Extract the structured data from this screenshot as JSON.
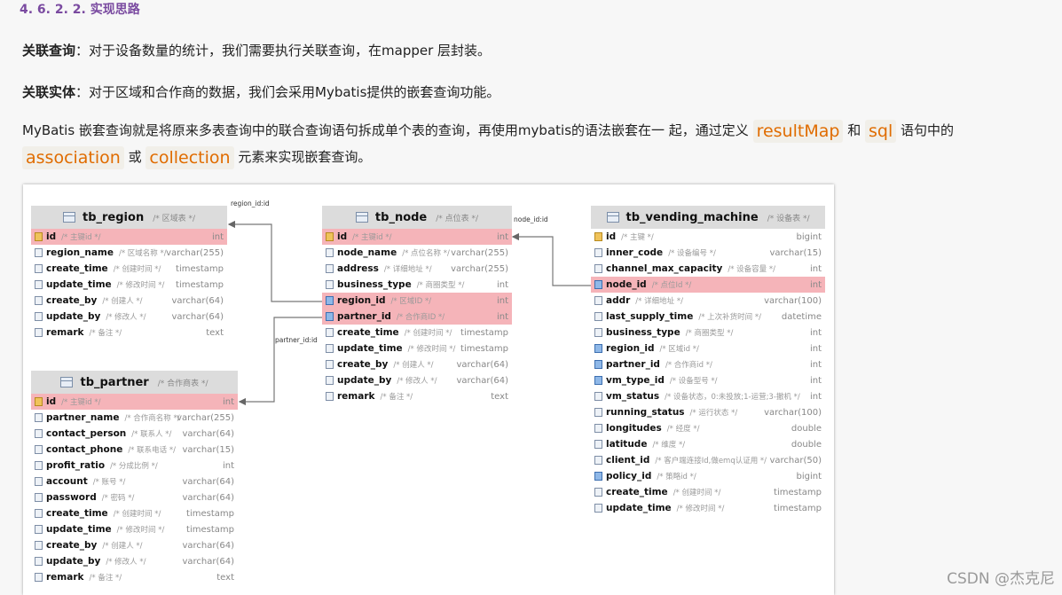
{
  "heading": "4. 6. 2. 2.  实现思路",
  "p1": {
    "bold": "关联查询",
    "text": "：对于设备数量的统计，我们需要执行关联查询，在mapper 层封装。"
  },
  "p2": {
    "bold": "关联实体",
    "text": "：对于区域和合作商的数据，我们会采用Mybatis提供的嵌套查询功能。"
  },
  "p3": {
    "a": "MyBatis 嵌套查询就是将原来多表查询中的联合查询语句拆成单个表的查询，再使用mybatis的语法嵌套在一 起，通过定义",
    "t1": "resultMap",
    "b": "和",
    "t2": "sql",
    "c": "语句中的",
    "t3": "association",
    "d": "或",
    "t4": "collection",
    "e": "元素来实现嵌套查询。"
  },
  "labels": {
    "region": "region_id:id",
    "node": "node_id:id",
    "partner": "partner_id:id"
  },
  "tables": {
    "region": {
      "name": "tb_region",
      "comment": "/* 区域表 */",
      "fields": [
        {
          "n": "id",
          "c": "/* 主键id */",
          "t": "int",
          "hl": true,
          "icon": "key"
        },
        {
          "n": "region_name",
          "c": "/* 区域名称 */",
          "t": "varchar(255)"
        },
        {
          "n": "create_time",
          "c": "/* 创建时间 */",
          "t": "timestamp"
        },
        {
          "n": "update_time",
          "c": "/* 修改时间 */",
          "t": "timestamp"
        },
        {
          "n": "create_by",
          "c": "/* 创建人 */",
          "t": "varchar(64)"
        },
        {
          "n": "update_by",
          "c": "/* 修改人 */",
          "t": "varchar(64)"
        },
        {
          "n": "remark",
          "c": "/* 备注 */",
          "t": "text"
        }
      ]
    },
    "partner": {
      "name": "tb_partner",
      "comment": "/* 合作商表 */",
      "fields": [
        {
          "n": "id",
          "c": "/* 主键id */",
          "t": "int",
          "hl": true,
          "icon": "key"
        },
        {
          "n": "partner_name",
          "c": "/* 合作商名称 */",
          "t": "varchar(255)"
        },
        {
          "n": "contact_person",
          "c": "/* 联系人 */",
          "t": "varchar(64)"
        },
        {
          "n": "contact_phone",
          "c": "/* 联系电话 */",
          "t": "varchar(15)"
        },
        {
          "n": "profit_ratio",
          "c": "/* 分成比例 */",
          "t": "int"
        },
        {
          "n": "account",
          "c": "/* 账号 */",
          "t": "varchar(64)"
        },
        {
          "n": "password",
          "c": "/* 密码 */",
          "t": "varchar(64)"
        },
        {
          "n": "create_time",
          "c": "/* 创建时间 */",
          "t": "timestamp"
        },
        {
          "n": "update_time",
          "c": "/* 修改时间 */",
          "t": "timestamp"
        },
        {
          "n": "create_by",
          "c": "/* 创建人 */",
          "t": "varchar(64)"
        },
        {
          "n": "update_by",
          "c": "/* 修改人 */",
          "t": "varchar(64)"
        },
        {
          "n": "remark",
          "c": "/* 备注 */",
          "t": "text"
        }
      ]
    },
    "node": {
      "name": "tb_node",
      "comment": "/* 点位表 */",
      "fields": [
        {
          "n": "id",
          "c": "/* 主键id */",
          "t": "int",
          "hl": true,
          "icon": "key"
        },
        {
          "n": "node_name",
          "c": "/* 点位名称 */",
          "t": "varchar(255)"
        },
        {
          "n": "address",
          "c": "/* 详细地址 */",
          "t": "varchar(255)"
        },
        {
          "n": "business_type",
          "c": "/* 商圈类型 */",
          "t": "int"
        },
        {
          "n": "region_id",
          "c": "/* 区域ID */",
          "t": "int",
          "hl": true,
          "icon": "idx"
        },
        {
          "n": "partner_id",
          "c": "/* 合作商ID */",
          "t": "int",
          "hl": true,
          "icon": "idx"
        },
        {
          "n": "create_time",
          "c": "/* 创建时间 */",
          "t": "timestamp"
        },
        {
          "n": "update_time",
          "c": "/* 修改时间 */",
          "t": "timestamp"
        },
        {
          "n": "create_by",
          "c": "/* 创建人 */",
          "t": "varchar(64)"
        },
        {
          "n": "update_by",
          "c": "/* 修改人 */",
          "t": "varchar(64)"
        },
        {
          "n": "remark",
          "c": "/* 备注 */",
          "t": "text"
        }
      ]
    },
    "vm": {
      "name": "tb_vending_machine",
      "comment": "/* 设备表 */",
      "fields": [
        {
          "n": "id",
          "c": "/* 主键 */",
          "t": "bigint",
          "icon": "key"
        },
        {
          "n": "inner_code",
          "c": "/* 设备编号 */",
          "t": "varchar(15)"
        },
        {
          "n": "channel_max_capacity",
          "c": "/* 设备容量 */",
          "t": "int"
        },
        {
          "n": "node_id",
          "c": "/* 点位Id */",
          "t": "int",
          "hl": true,
          "icon": "idx"
        },
        {
          "n": "addr",
          "c": "/* 详细地址 */",
          "t": "varchar(100)"
        },
        {
          "n": "last_supply_time",
          "c": "/* 上次补货时间 */",
          "t": "datetime"
        },
        {
          "n": "business_type",
          "c": "/* 商圈类型 */",
          "t": "int"
        },
        {
          "n": "region_id",
          "c": "/* 区域id */",
          "t": "int",
          "icon": "idx"
        },
        {
          "n": "partner_id",
          "c": "/* 合作商id */",
          "t": "int",
          "icon": "idx"
        },
        {
          "n": "vm_type_id",
          "c": "/* 设备型号 */",
          "t": "int",
          "icon": "idx"
        },
        {
          "n": "vm_status",
          "c": "/* 设备状态，0:未投放;1-运营;3-撤机 */",
          "t": "int"
        },
        {
          "n": "running_status",
          "c": "/* 运行状态 */",
          "t": "varchar(100)"
        },
        {
          "n": "longitudes",
          "c": "/* 经度 */",
          "t": "double"
        },
        {
          "n": "latitude",
          "c": "/* 维度 */",
          "t": "double"
        },
        {
          "n": "client_id",
          "c": "/* 客户端连接Id,做emq认证用 */",
          "t": "varchar(50)"
        },
        {
          "n": "policy_id",
          "c": "/* 策略id */",
          "t": "bigint",
          "icon": "idx"
        },
        {
          "n": "create_time",
          "c": "/* 创建时间 */",
          "t": "timestamp"
        },
        {
          "n": "update_time",
          "c": "/* 修改时间 */",
          "t": "timestamp"
        }
      ]
    }
  },
  "watermark": "CSDN @杰克尼"
}
